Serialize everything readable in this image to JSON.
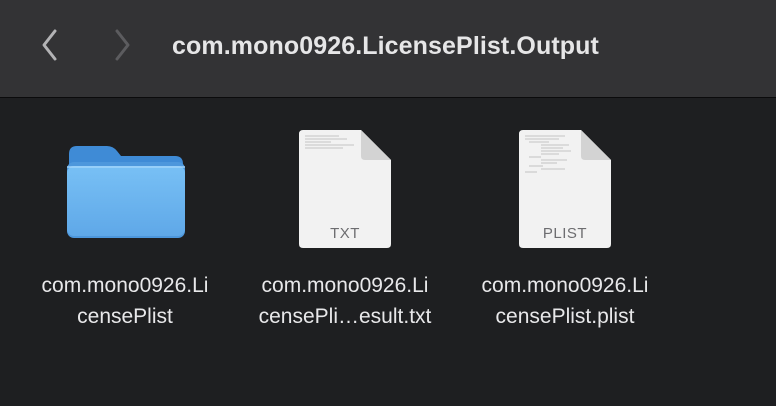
{
  "window": {
    "title": "com.mono0926.LicensePlist.Output"
  },
  "toolbar": {
    "back_icon": "chevron-left-icon",
    "forward_icon": "chevron-right-icon"
  },
  "items": [
    {
      "type": "folder",
      "icon": "folder-icon",
      "name_line1": "com.mono0926.Li",
      "name_line2": "censePlist"
    },
    {
      "type": "text-document",
      "icon": "text-document-icon",
      "badge": "TXT",
      "name_line1": "com.mono0926.Li",
      "name_line2": "censePli…esult.txt"
    },
    {
      "type": "plist-document",
      "icon": "plist-document-icon",
      "badge": "PLIST",
      "name_line1": "com.mono0926.Li",
      "name_line2": "censePlist.plist"
    }
  ],
  "colors": {
    "toolbar_bg": "#333335",
    "content_bg": "#1e1f21",
    "folder_blue": "#70b8f1",
    "title_text": "#e6e6e7"
  }
}
